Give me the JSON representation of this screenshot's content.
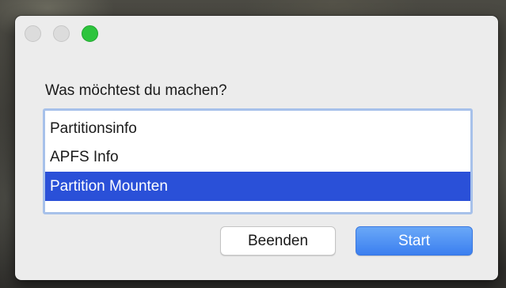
{
  "dialog": {
    "prompt": "Was möchtest du machen?",
    "options": [
      {
        "label": "Partitionsinfo",
        "selected": false
      },
      {
        "label": "APFS Info",
        "selected": false
      },
      {
        "label": "Partition Mounten",
        "selected": true
      }
    ],
    "buttons": {
      "quit_label": "Beenden",
      "start_label": "Start"
    }
  },
  "colors": {
    "selection": "#2a50d8",
    "default_button": "#3b7ff0",
    "zoom_button": "#2dc43d",
    "window_background": "#ececec"
  }
}
